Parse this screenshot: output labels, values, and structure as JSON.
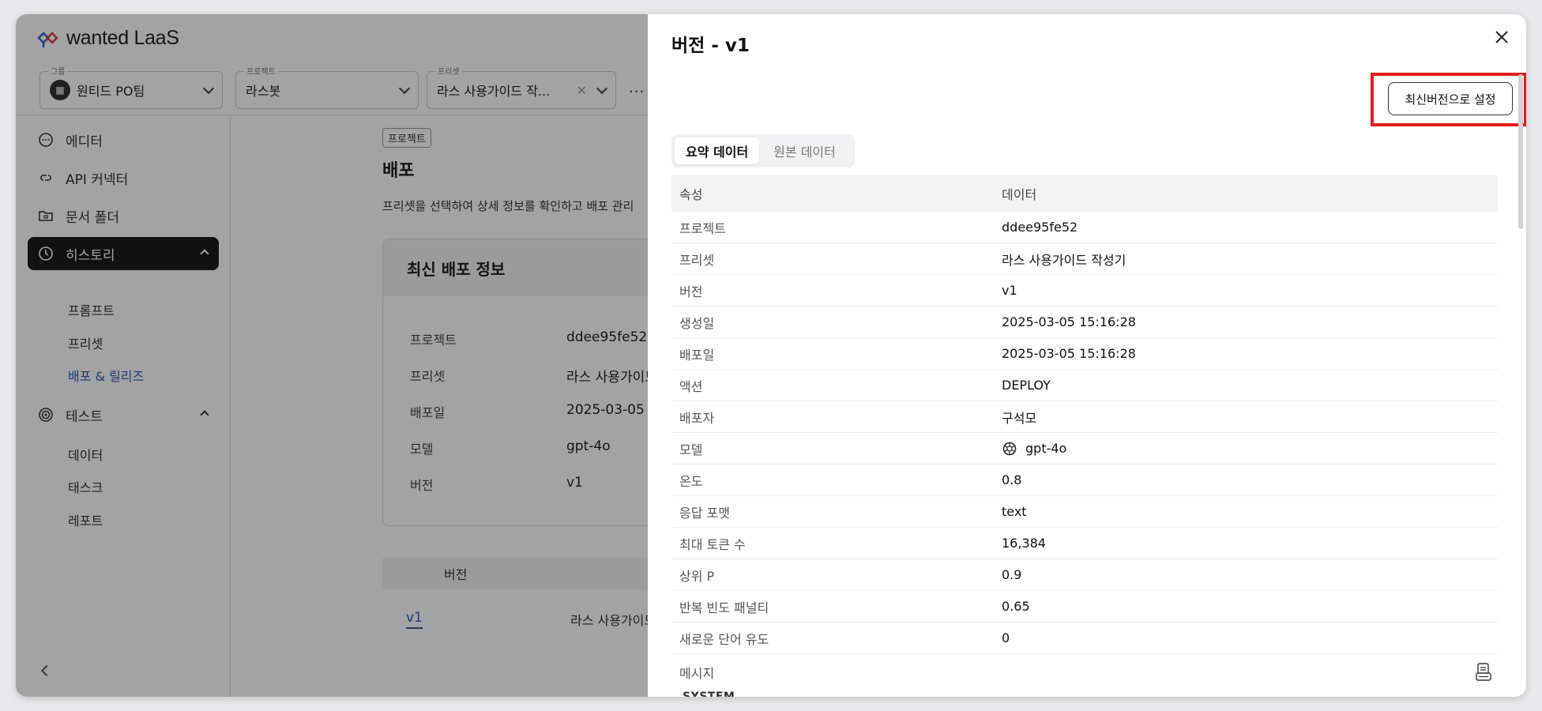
{
  "app": {
    "logo_text": "wanted LaaS",
    "selectors": {
      "group": {
        "label": "그룹",
        "value": "원티드 PO팀"
      },
      "project": {
        "label": "프로젝트",
        "value": "라스봇"
      },
      "preset": {
        "label": "프리셋",
        "value": "라스 사용가이드 작..."
      }
    },
    "more": "···"
  },
  "sidebar": {
    "items": [
      {
        "label": "에디터",
        "icon": "chat-bubble-icon"
      },
      {
        "label": "API 커넥터",
        "icon": "link-icon"
      },
      {
        "label": "문서 폴더",
        "icon": "folder-icon"
      },
      {
        "label": "히스토리",
        "icon": "clock-icon",
        "active": true
      },
      {
        "label": "테스트",
        "icon": "target-icon"
      }
    ],
    "history_sub": [
      "프롬프트",
      "프리셋",
      "배포 & 릴리즈"
    ],
    "test_sub": [
      "데이터",
      "태스크",
      "레포트"
    ]
  },
  "main": {
    "breadcrumb": "프로젝트",
    "title": "배포",
    "description": "프리셋을 선택하여 상세 정보를 확인하고 배포 관리",
    "card": {
      "title": "최신 배포 정보",
      "rows": [
        {
          "label": "프로젝트",
          "value": "ddee95fe52"
        },
        {
          "label": "프리셋",
          "value": "라스 사용가이드"
        },
        {
          "label": "배포일",
          "value": "2025-03-05"
        },
        {
          "label": "모델",
          "value": "gpt-4o"
        },
        {
          "label": "버전",
          "value": "v1"
        }
      ]
    },
    "list_header": "버전",
    "list_row": {
      "version": "v1",
      "preset": "라스 사용가이드 ?"
    }
  },
  "drawer": {
    "title": "버전 - v1",
    "set_latest_label": "최신버전으로 설정",
    "tabs": [
      "요약 데이터",
      "원본 데이터"
    ],
    "table_header": {
      "attr": "속성",
      "data": "데이터"
    },
    "rows": [
      {
        "label": "프로젝트",
        "value": "ddee95fe52"
      },
      {
        "label": "프리셋",
        "value": "라스 사용가이드 작성기"
      },
      {
        "label": "버전",
        "value": "v1"
      },
      {
        "label": "생성일",
        "value": "2025-03-05 15:16:28"
      },
      {
        "label": "배포일",
        "value": "2025-03-05 15:16:28"
      },
      {
        "label": "액션",
        "value": "DEPLOY"
      },
      {
        "label": "배포자",
        "value": "구석모"
      },
      {
        "label": "모델",
        "value": "gpt-4o"
      },
      {
        "label": "온도",
        "value": "0.8"
      },
      {
        "label": "응답 포맷",
        "value": "text"
      },
      {
        "label": "최대 토큰 수",
        "value": "16,384"
      },
      {
        "label": "상위 P",
        "value": "0.9"
      },
      {
        "label": "반복 빈도 패널티",
        "value": "0.65"
      },
      {
        "label": "새로운 단어 유도",
        "value": "0"
      }
    ],
    "message_label": "메시지",
    "system_label": "SYSTEM"
  },
  "colors": {
    "highlight": "#e0201b",
    "active_nav": "#1b1b1b",
    "link": "#2b5ab8"
  }
}
